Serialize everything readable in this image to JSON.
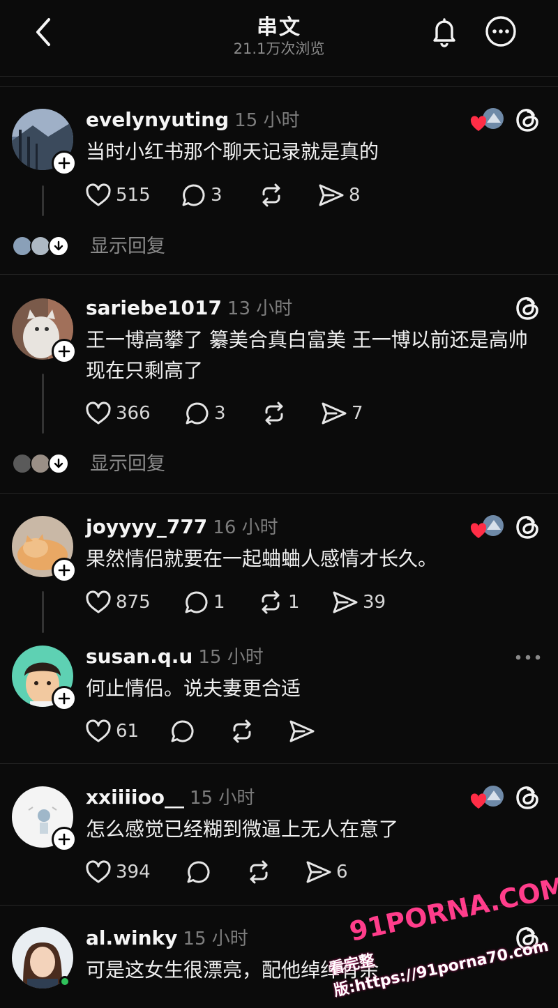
{
  "header": {
    "title": "串文",
    "views": "21.1万次浏览"
  },
  "posts": [
    {
      "username": "evelynyuting",
      "time": "15 小时",
      "text": "当时小红书那个聊天记录就是真的",
      "likes": "515",
      "comments": "3",
      "reposts": "",
      "shares": "8",
      "show_replies": "显示回复"
    },
    {
      "username": "sariebe1017",
      "time": "13 小时",
      "text": "王一博高攀了 纂美合真白富美 王一博以前还是高帅 现在只剩高了",
      "likes": "366",
      "comments": "3",
      "reposts": "",
      "shares": "7",
      "show_replies": "显示回复"
    },
    {
      "username": "joyyyy_777",
      "time": "16 小时",
      "text": "果然情侣就要在一起蛐蛐人感情才长久。",
      "likes": "875",
      "comments": "1",
      "reposts": "1",
      "shares": "39"
    },
    {
      "username": "susan.q.u",
      "time": "15 小时",
      "text": "何止情侣。说夫妻更合适",
      "likes": "61",
      "comments": "",
      "reposts": "",
      "shares": ""
    },
    {
      "username": "xxiiiioo__",
      "time": "15 小时",
      "text": "怎么感觉已经糊到微逼上无人在意了",
      "likes": "394",
      "comments": "",
      "reposts": "",
      "shares": "6"
    },
    {
      "username": "al.winky",
      "time": "15 小时",
      "text": "可是这女生很漂亮，配他绰绰有余"
    }
  ],
  "watermark": {
    "brand": "91PORNA.COM",
    "line": "看完整版:https://91porna70.com"
  },
  "colors": {
    "background": "#0b0b0b",
    "heart": "#ff2d46",
    "muted": "#7d7d7d"
  }
}
